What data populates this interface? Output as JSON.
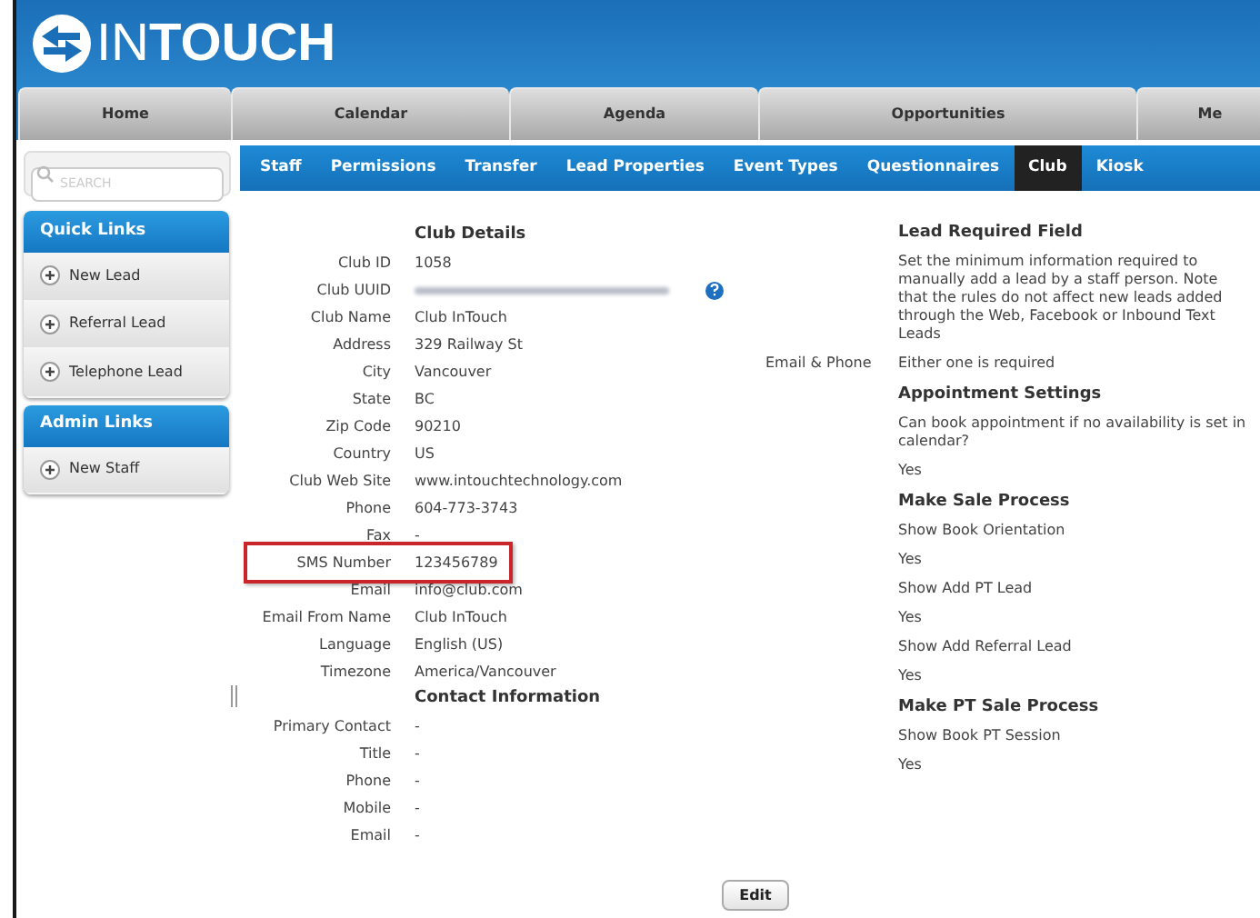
{
  "logo": {
    "text_light": "IN",
    "text_bold": "TOUCH"
  },
  "main_nav": [
    {
      "label": "Home",
      "selected": false
    },
    {
      "label": "Calendar",
      "selected": false
    },
    {
      "label": "Agenda",
      "selected": false
    },
    {
      "label": "Opportunities",
      "selected": false
    },
    {
      "label": "Me",
      "selected": false
    }
  ],
  "search": {
    "placeholder": "SEARCH"
  },
  "sub_nav": [
    {
      "label": "Staff",
      "selected": false
    },
    {
      "label": "Permissions",
      "selected": false
    },
    {
      "label": "Transfer",
      "selected": false
    },
    {
      "label": "Lead Properties",
      "selected": false
    },
    {
      "label": "Event Types",
      "selected": false
    },
    {
      "label": "Questionnaires",
      "selected": false
    },
    {
      "label": "Club",
      "selected": true
    },
    {
      "label": "Kiosk",
      "selected": false
    }
  ],
  "sidebar": [
    {
      "title": "Quick Links",
      "items": [
        "New Lead",
        "Referral Lead",
        "Telephone Lead"
      ]
    },
    {
      "title": "Admin Links",
      "items": [
        "New Staff"
      ]
    }
  ],
  "details": [
    {
      "kind": "heading",
      "text": "Club Details"
    },
    {
      "kind": "pair",
      "label": "Club ID",
      "value": "1058"
    },
    {
      "kind": "blurred",
      "label": "Club UUID"
    },
    {
      "kind": "pair",
      "label": "Club Name",
      "value": "Club InTouch"
    },
    {
      "kind": "pair",
      "label": "Address",
      "value": "329 Railway St"
    },
    {
      "kind": "pair",
      "label": "City",
      "value": "Vancouver"
    },
    {
      "kind": "pair",
      "label": "State",
      "value": "BC"
    },
    {
      "kind": "pair",
      "label": "Zip Code",
      "value": "90210"
    },
    {
      "kind": "pair",
      "label": "Country",
      "value": "US"
    },
    {
      "kind": "pair",
      "label": "Club Web Site",
      "value": "www.intouchtechnology.com"
    },
    {
      "kind": "pair",
      "label": "Phone",
      "value": "604-773-3743"
    },
    {
      "kind": "pair",
      "label": "Fax",
      "value": "-"
    },
    {
      "kind": "pair",
      "label": "SMS Number",
      "value": "123456789",
      "highlighted": true
    },
    {
      "kind": "pair",
      "label": "Email",
      "value": "info@club.com"
    },
    {
      "kind": "pair",
      "label": "Email From Name",
      "value": "Club InTouch"
    },
    {
      "kind": "pair",
      "label": "Language",
      "value": "English (US)"
    },
    {
      "kind": "pair",
      "label": "Timezone",
      "value": "America/Vancouver"
    },
    {
      "kind": "heading",
      "text": "Contact Information"
    },
    {
      "kind": "pair",
      "label": "Primary Contact",
      "value": "-"
    },
    {
      "kind": "pair",
      "label": "Title",
      "value": "-"
    },
    {
      "kind": "pair",
      "label": "Phone",
      "value": "-"
    },
    {
      "kind": "pair",
      "label": "Mobile",
      "value": "-"
    },
    {
      "kind": "pair",
      "label": "Email",
      "value": "-"
    }
  ],
  "settings": [
    {
      "kind": "heading",
      "text": "Lead Required Field"
    },
    {
      "kind": "note",
      "text": "Set the minimum information required to manually add a lead by a staff person. Note that the rules do not affect new leads added through the Web, Facebook or Inbound Text Leads"
    },
    {
      "kind": "pair",
      "label": "Email & Phone",
      "value": "Either one is required"
    },
    {
      "kind": "heading",
      "text": "Appointment Settings"
    },
    {
      "kind": "note",
      "text": "Can book appointment if no availability is set in calendar?"
    },
    {
      "kind": "value",
      "text": "Yes"
    },
    {
      "kind": "heading",
      "text": "Make Sale Process"
    },
    {
      "kind": "note",
      "text": "Show Book Orientation"
    },
    {
      "kind": "value",
      "text": "Yes"
    },
    {
      "kind": "note",
      "text": "Show Add PT Lead"
    },
    {
      "kind": "value",
      "text": "Yes"
    },
    {
      "kind": "note",
      "text": "Show Add Referral Lead"
    },
    {
      "kind": "value",
      "text": "Yes"
    },
    {
      "kind": "heading",
      "text": "Make PT Sale Process"
    },
    {
      "kind": "note",
      "text": "Show Book PT Session"
    },
    {
      "kind": "value",
      "text": "Yes"
    }
  ],
  "edit_button": "Edit"
}
